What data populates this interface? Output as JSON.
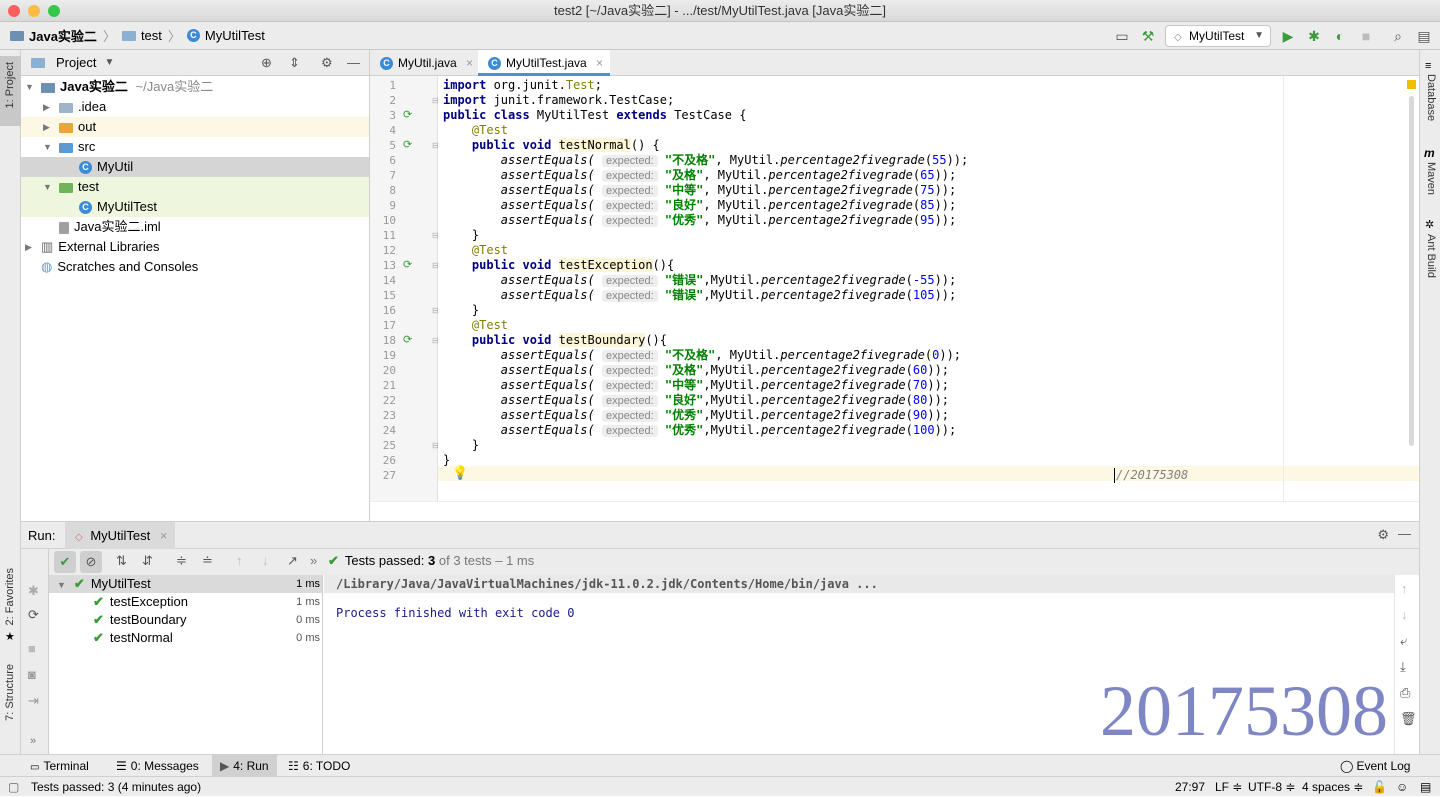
{
  "window": {
    "title": "test2 [~/Java实验二] - .../test/MyUtilTest.java [Java实验二]"
  },
  "breadcrumb": {
    "project": "Java实验二",
    "folder": "test",
    "file": "MyUtilTest"
  },
  "toolbar": {
    "run_config": "MyUtilTest"
  },
  "left_strip": {
    "project_tab": "1: Project",
    "favorites_tab": "2: Favorites",
    "structure_tab": "7: Structure"
  },
  "right_strip": {
    "database": "Database",
    "maven": "Maven",
    "ant": "Ant Build"
  },
  "project_panel": {
    "title": "Project",
    "root": {
      "name": "Java实验二",
      "path": "~/Java实验二"
    },
    "items": [
      {
        "label": ".idea"
      },
      {
        "label": "out"
      },
      {
        "label": "src"
      },
      {
        "label": "MyUtil"
      },
      {
        "label": "test"
      },
      {
        "label": "MyUtilTest"
      },
      {
        "label": "Java实验二.iml"
      },
      {
        "label": "External Libraries"
      },
      {
        "label": "Scratches and Consoles"
      }
    ]
  },
  "editor": {
    "tabs": [
      {
        "label": "MyUtil.java"
      },
      {
        "label": "MyUtilTest.java"
      }
    ],
    "active_tab": 1,
    "lines": [
      "1",
      "2",
      "3",
      "4",
      "5",
      "6",
      "7",
      "8",
      "9",
      "10",
      "11",
      "12",
      "13",
      "14",
      "15",
      "16",
      "17",
      "18",
      "19",
      "20",
      "21",
      "22",
      "23",
      "24",
      "25",
      "26",
      "27"
    ],
    "code": {
      "l1_import": "import",
      "l1_rest": " org.junit.",
      "l1_test": "Test",
      "l1_end": ";",
      "l2_import": "import",
      "l2_rest": " junit.framework.TestCase;",
      "l3_public": "public class",
      "l3_name": " MyUtilTest ",
      "l3_extends": "extends",
      "l3_rest": " TestCase {",
      "annotation": "@Test",
      "public_void": "public void",
      "m1": "testNormal",
      "m1_rest": "() {",
      "m2": "testException",
      "m2_rest": "(){",
      "m3": "testBoundary",
      "m3_rest": "(){",
      "assert": "assertEquals(",
      "hint": "expected:",
      "call": "MyUtil.",
      "fn": "percentage2fivegrade",
      "close_brace": "}",
      "comment": "//20175308",
      "rows_normal": [
        {
          "s": "\"不及格\"",
          "n": "55"
        },
        {
          "s": "\"及格\"",
          "n": "65"
        },
        {
          "s": "\"中等\"",
          "n": "75"
        },
        {
          "s": "\"良好\"",
          "n": "85"
        },
        {
          "s": "\"优秀\"",
          "n": "95"
        }
      ],
      "rows_exception": [
        {
          "s": "\"错误\"",
          "n": "-55"
        },
        {
          "s": "\"错误\"",
          "n": "105"
        }
      ],
      "rows_boundary": [
        {
          "s": "\"不及格\"",
          "n": "0"
        },
        {
          "s": "\"及格\"",
          "n": "60"
        },
        {
          "s": "\"中等\"",
          "n": "70"
        },
        {
          "s": "\"良好\"",
          "n": "80"
        },
        {
          "s": "\"优秀\"",
          "n": "90"
        },
        {
          "s": "\"优秀\"",
          "n": "100"
        }
      ]
    }
  },
  "run_panel": {
    "label": "Run:",
    "config": "MyUtilTest",
    "status_prefix": "Tests passed: ",
    "status_count": "3",
    "status_suffix": " of 3 tests – 1 ms",
    "tests": [
      {
        "name": "MyUtilTest",
        "time": "1 ms"
      },
      {
        "name": "testException",
        "time": "1 ms"
      },
      {
        "name": "testBoundary",
        "time": "0 ms"
      },
      {
        "name": "testNormal",
        "time": "0 ms"
      }
    ],
    "console": {
      "cmd": "/Library/Java/JavaVirtualMachines/jdk-11.0.2.jdk/Contents/Home/bin/java ...",
      "exit": "Process finished with exit code 0"
    },
    "watermark": "20175308"
  },
  "bottom_tabs": [
    {
      "label": "Terminal"
    },
    {
      "label": "0: Messages"
    },
    {
      "label": "4: Run"
    },
    {
      "label": "6: TODO"
    }
  ],
  "event_log": "Event Log",
  "status": {
    "message": "Tests passed: 3 (4 minutes ago)",
    "position": "27:97",
    "line_sep": "LF ≑",
    "encoding": "UTF-8 ≑",
    "indent": "4 spaces ≑"
  }
}
